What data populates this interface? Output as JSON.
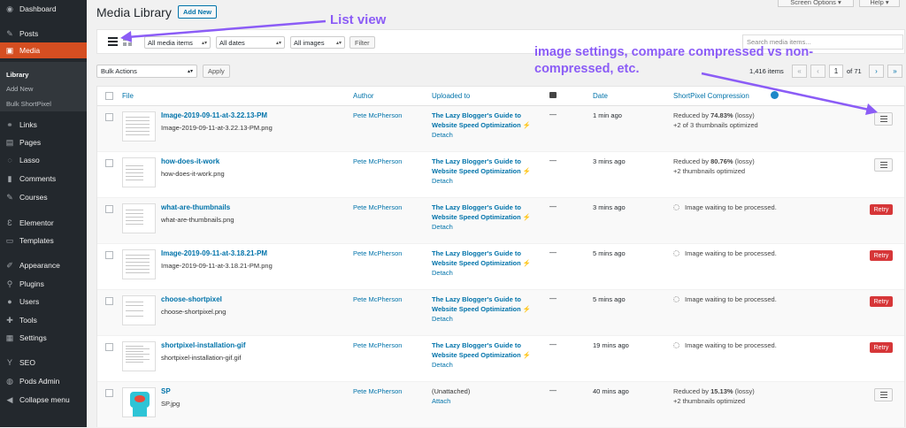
{
  "sidebar": {
    "items": [
      {
        "label": "Dashboard",
        "icon": "dashboard-icon",
        "glyph": "◉"
      },
      {
        "label": "Posts",
        "icon": "pin-icon",
        "glyph": "✎"
      },
      {
        "label": "Media",
        "icon": "media-icon",
        "glyph": "▣"
      },
      {
        "label": "Links",
        "icon": "links-icon",
        "glyph": "⚭"
      },
      {
        "label": "Pages",
        "icon": "pages-icon",
        "glyph": "▤"
      },
      {
        "label": "Lasso",
        "icon": "lasso-icon",
        "glyph": "◌"
      },
      {
        "label": "Comments",
        "icon": "comment-icon",
        "glyph": "▮"
      },
      {
        "label": "Courses",
        "icon": "courses-icon",
        "glyph": "✎"
      },
      {
        "label": "Elementor",
        "icon": "elementor-icon",
        "glyph": "Ɛ"
      },
      {
        "label": "Templates",
        "icon": "templates-icon",
        "glyph": "▭"
      },
      {
        "label": "Appearance",
        "icon": "appearance-icon",
        "glyph": "✐"
      },
      {
        "label": "Plugins",
        "icon": "plugins-icon",
        "glyph": "⚲"
      },
      {
        "label": "Users",
        "icon": "users-icon",
        "glyph": "●"
      },
      {
        "label": "Tools",
        "icon": "tools-icon",
        "glyph": "✚"
      },
      {
        "label": "Settings",
        "icon": "settings-icon",
        "glyph": "▦"
      },
      {
        "label": "SEO",
        "icon": "seo-icon",
        "glyph": "Y"
      },
      {
        "label": "Pods Admin",
        "icon": "pods-icon",
        "glyph": "◍"
      },
      {
        "label": "Collapse menu",
        "icon": "collapse-icon",
        "glyph": "◀"
      }
    ],
    "submenu": [
      "Library",
      "Add New",
      "Bulk ShortPixel"
    ]
  },
  "header": {
    "title": "Media Library",
    "add_new": "Add New",
    "screen_options": "Screen Options ▾",
    "help": "Help ▾"
  },
  "filters": {
    "type": "All media items",
    "dates": "All dates",
    "format": "All images",
    "filter_btn": "Filter",
    "search_placeholder": "Search media items..."
  },
  "bulk": {
    "select": "Bulk Actions",
    "apply": "Apply"
  },
  "pagination": {
    "items": "1,416 items",
    "first": "«",
    "prev": "‹",
    "current": "1",
    "of": "of 71",
    "next": "›",
    "last": "»"
  },
  "columns": {
    "file": "File",
    "author": "Author",
    "uploaded_to": "Uploaded to",
    "date": "Date",
    "shortpixel": "ShortPixel Compression"
  },
  "rows": [
    {
      "title": "Image-2019-09-11-at-3.22.13-PM",
      "file": "Image-2019-09-11-at-3.22.13-PM.png",
      "author": "Pete McPherson",
      "up1": "The Lazy Blogger's Guide to",
      "up2": "Website Speed Optimization",
      "action": "Detach",
      "dash": "—",
      "date": "1 min ago",
      "sp_a": "Reduced by ",
      "sp_pct": "74.83%",
      "sp_b": " (lossy)",
      "sp2": "+2 of 3 thumbnails optimized",
      "btn": "menu"
    },
    {
      "title": "how-does-it-work",
      "file": "how-does-it-work.png",
      "author": "Pete McPherson",
      "up1": "The Lazy Blogger's Guide to",
      "up2": "Website Speed Optimization",
      "action": "Detach",
      "dash": "—",
      "date": "3 mins ago",
      "sp_a": "Reduced by ",
      "sp_pct": "80.76%",
      "sp_b": " (lossy)",
      "sp2": "+2 thumbnails optimized",
      "btn": "menu"
    },
    {
      "title": "what-are-thumbnails",
      "file": "what-are-thumbnails.png",
      "author": "Pete McPherson",
      "up1": "The Lazy Blogger's Guide to",
      "up2": "Website Speed Optimization",
      "action": "Detach",
      "dash": "—",
      "date": "3 mins ago",
      "waiting": "Image waiting to be processed.",
      "btn": "retry"
    },
    {
      "title": "Image-2019-09-11-at-3.18.21-PM",
      "file": "Image-2019-09-11-at-3.18.21-PM.png",
      "author": "Pete McPherson",
      "up1": "The Lazy Blogger's Guide to",
      "up2": "Website Speed Optimization",
      "action": "Detach",
      "dash": "—",
      "date": "5 mins ago",
      "waiting": "Image waiting to be processed.",
      "btn": "retry"
    },
    {
      "title": "choose-shortpixel",
      "file": "choose-shortpixel.png",
      "author": "Pete McPherson",
      "up1": "The Lazy Blogger's Guide to",
      "up2": "Website Speed Optimization",
      "action": "Detach",
      "dash": "—",
      "date": "5 mins ago",
      "waiting": "Image waiting to be processed.",
      "btn": "retry"
    },
    {
      "title": "shortpixel-installation-gif",
      "file": "shortpixel-installation-gif.gif",
      "author": "Pete McPherson",
      "up1": "The Lazy Blogger's Guide to",
      "up2": "Website Speed Optimization",
      "action": "Detach",
      "dash": "—",
      "date": "19 mins ago",
      "waiting": "Image waiting to be processed.",
      "btn": "retry"
    },
    {
      "title": "SP",
      "file": "SP.jpg",
      "author": "Pete McPherson",
      "up1": "(Unattached)",
      "up2": "",
      "action": "Attach",
      "dash": "—",
      "date": "40 mins ago",
      "sp_a": "Reduced by ",
      "sp_pct": "15.13%",
      "sp_b": " (lossy)",
      "sp2": "+2 thumbnails optimized",
      "btn": "menu"
    }
  ],
  "retry_label": "Retry",
  "bolt": "⚡",
  "annotations": {
    "list_view": "List view",
    "settings_note_1": "image settings, compare compressed vs non-",
    "settings_note_2": "compressed, etc.",
    "color": "#8b5cf6"
  }
}
